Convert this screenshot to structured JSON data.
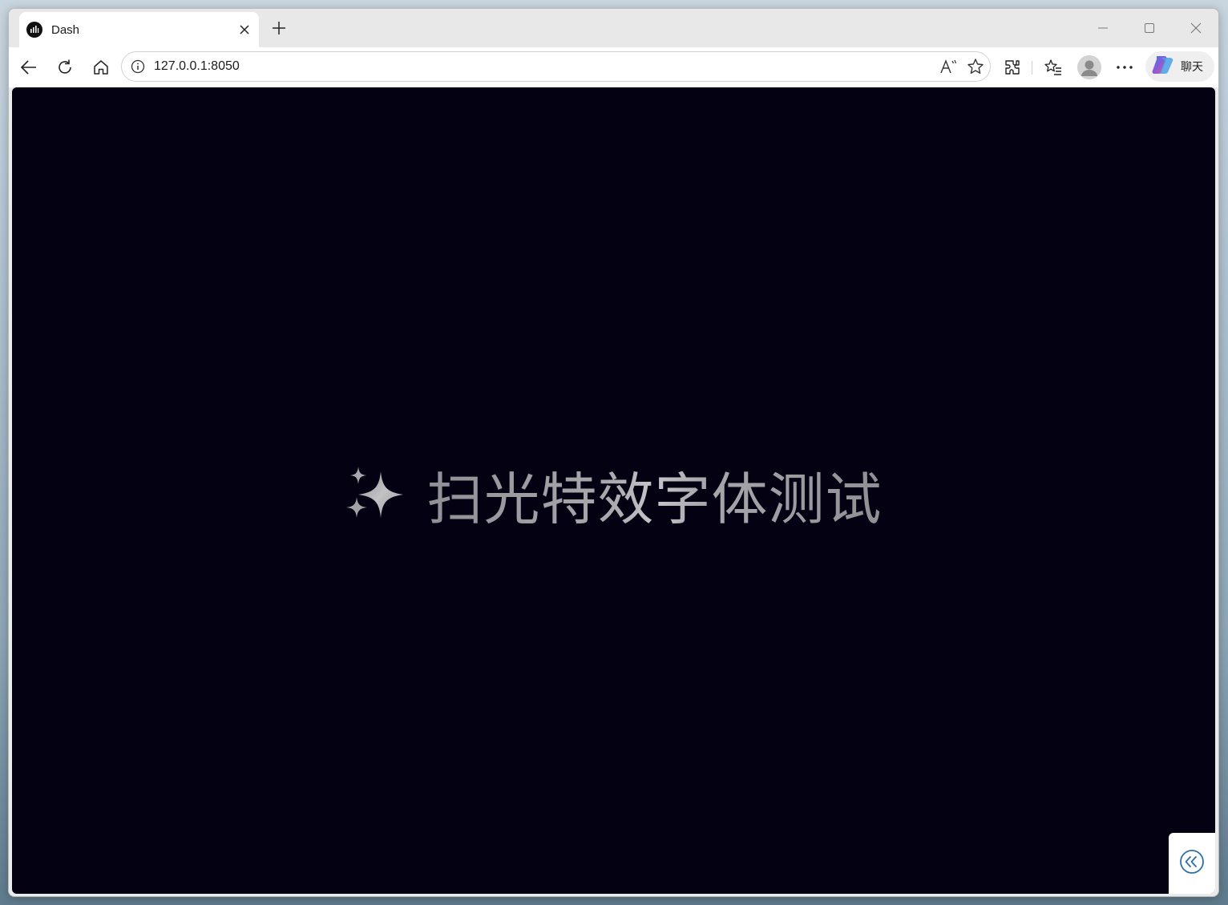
{
  "browser": {
    "tab_title": "Dash",
    "address": "127.0.0.1:8050",
    "copilot_label": "聊天"
  },
  "icons": {
    "favicon": "dash-favicon-icon",
    "tab_close": "close-icon",
    "new_tab": "plus-icon",
    "minimize": "minimize-icon",
    "maximize": "maximize-icon",
    "window_close": "close-icon",
    "back": "arrow-left-icon",
    "refresh": "refresh-icon",
    "home": "home-icon",
    "site_info": "info-icon",
    "read_aloud": "read-aloud-icon",
    "favorite": "star-icon",
    "extensions": "puzzle-icon",
    "favorites": "favorites-list-icon",
    "profile": "user-avatar-icon",
    "more": "more-icon",
    "copilot": "copilot-icon",
    "sparkle": "sparkles-icon",
    "collapse": "double-chevron-left-icon"
  },
  "page": {
    "heading_emoji": "✨",
    "heading": "扫光特效字体测试"
  },
  "colors": {
    "page_background": "#040112",
    "heading_text": "#a3a3a8"
  }
}
